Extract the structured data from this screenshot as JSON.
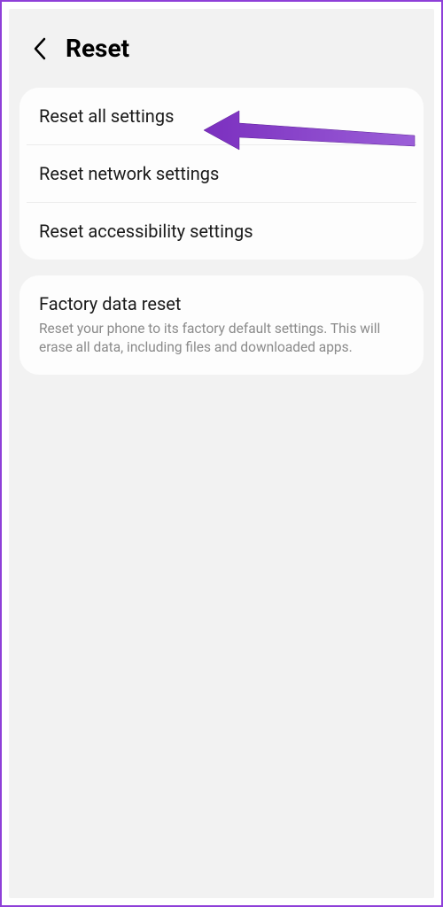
{
  "header": {
    "title": "Reset"
  },
  "group1": {
    "items": [
      {
        "title": "Reset all settings"
      },
      {
        "title": "Reset network settings"
      },
      {
        "title": "Reset accessibility settings"
      }
    ]
  },
  "group2": {
    "item": {
      "title": "Factory data reset",
      "desc": "Reset your phone to its factory default settings. This will erase all data, including files and downloaded apps."
    }
  },
  "annotation": {
    "arrow_color": "#7b2fbf"
  }
}
